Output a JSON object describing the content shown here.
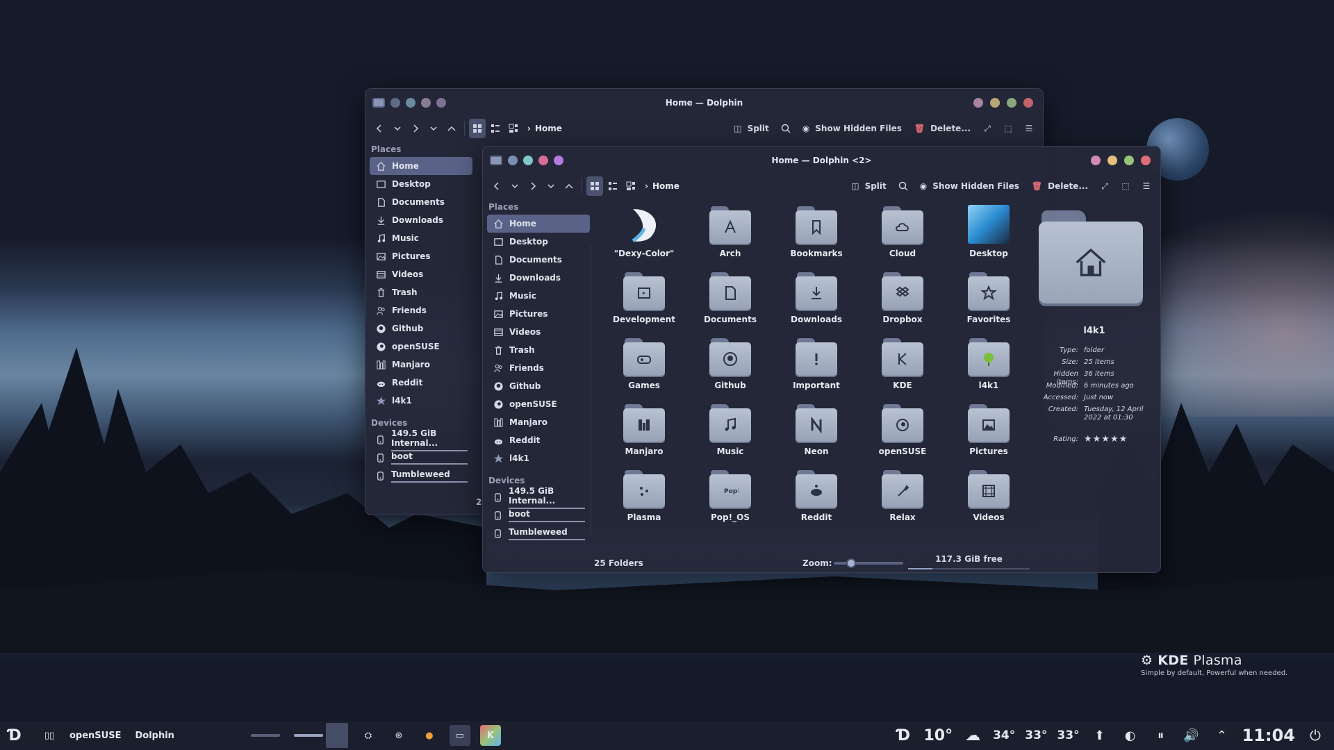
{
  "wallpaper": {
    "brand": "KDE Plasma",
    "brand_bold": "KDE",
    "brand_light": "Plasma",
    "tagline": "Simple by default, Powerful when  needed."
  },
  "back_window": {
    "title": "Home — Dolphin",
    "breadcrumb": "Home",
    "toolbar": {
      "split": "Split",
      "hidden": "Show Hidden Files",
      "delete": "Delete..."
    },
    "places_header": "Places",
    "places": [
      "Home",
      "Desktop",
      "Documents",
      "Downloads",
      "Music",
      "Pictures",
      "Videos",
      "Trash",
      "Friends",
      "Github",
      "openSUSE",
      "Manjaro",
      "Reddit",
      "l4k1"
    ],
    "devices_header": "Devices",
    "devices": [
      "149.5 GiB Internal...",
      "boot",
      "Tumbleweed"
    ],
    "partial": "2"
  },
  "front_window": {
    "title": "Home — Dolphin <2>",
    "breadcrumb": "Home",
    "toolbar": {
      "split": "Split",
      "hidden": "Show Hidden Files",
      "delete": "Delete..."
    },
    "places_header": "Places",
    "places": [
      "Home",
      "Desktop",
      "Documents",
      "Downloads",
      "Music",
      "Pictures",
      "Videos",
      "Trash",
      "Friends",
      "Github",
      "openSUSE",
      "Manjaro",
      "Reddit",
      "l4k1"
    ],
    "devices_header": "Devices",
    "devices": [
      "149.5 GiB Internal...",
      "boot",
      "Tumbleweed"
    ],
    "files": [
      "\"Dexy-Color\"",
      "Arch",
      "Bookmarks",
      "Cloud",
      "Desktop",
      "Development",
      "Documents",
      "Downloads",
      "Dropbox",
      "Favorites",
      "Games",
      "Github",
      "Important",
      "KDE",
      "l4k1",
      "Manjaro",
      "Music",
      "Neon",
      "openSUSE",
      "Pictures",
      "Plasma",
      "Pop!_OS",
      "Reddit",
      "Relax",
      "Videos"
    ],
    "emblems": [
      "dexy",
      "A",
      "bookmark",
      "cloud",
      "desktop",
      "dev",
      "docs",
      "download",
      "dropbox",
      "star",
      "gamepad",
      "github",
      "!",
      "K",
      "l4k1",
      "manjaro",
      "music",
      "N",
      "opensuse",
      "picture",
      "plasma",
      "pop",
      "reddit",
      "wrench",
      "video"
    ],
    "info": {
      "name": "l4k1",
      "rows": [
        {
          "k": "Type:",
          "v": "folder"
        },
        {
          "k": "Size:",
          "v": "25 items"
        },
        {
          "k": "Hidden items:",
          "v": "36 items"
        },
        {
          "k": "Modified:",
          "v": "6 minutes ago"
        },
        {
          "k": "Accessed:",
          "v": "Just now"
        },
        {
          "k": "Created:",
          "v": "Tuesday, 12 April 2022 at 01:30"
        },
        {
          "k": "Rating:",
          "v": "★★★★★"
        }
      ]
    },
    "status": {
      "count": "25 Folders",
      "zoom_label": "Zoom:",
      "free": "117.3 GiB free",
      "zoom_level": 0.25,
      "used_fraction": 0.2
    }
  },
  "taskbar": {
    "pager": "openSUSE",
    "app": "Dolphin",
    "temp": "10°",
    "temps": [
      "34°",
      "33°",
      "33°"
    ],
    "clock": "11:04"
  },
  "colors": {
    "accent": "#5a6288",
    "dot_red": "#e06c75",
    "dot_green": "#98c379",
    "dot_yellow": "#e5c07b",
    "dot_purple": "#c678dd"
  }
}
